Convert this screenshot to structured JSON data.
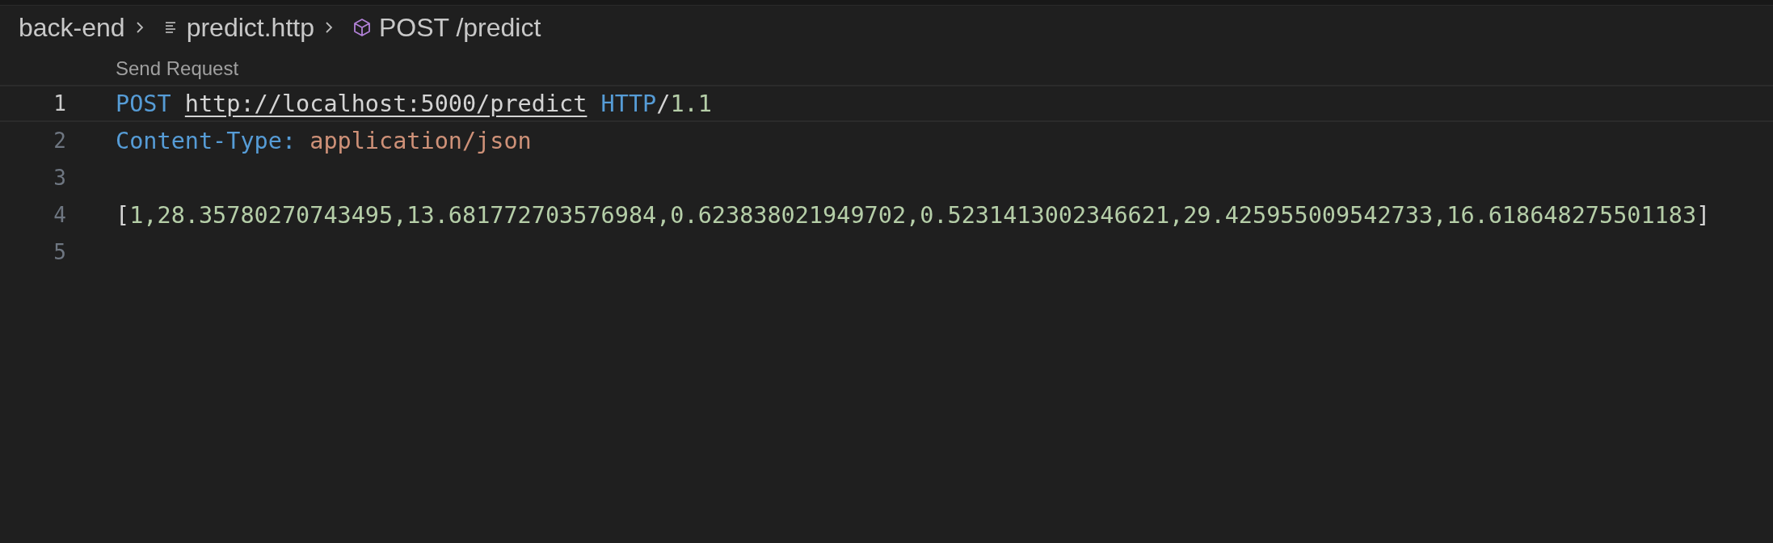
{
  "breadcrumbs": [
    {
      "label": "back-end",
      "kind": "folder"
    },
    {
      "label": "predict.http",
      "kind": "file"
    },
    {
      "label": "POST /predict",
      "kind": "symbol"
    }
  ],
  "codelens": "Send Request",
  "lines": [
    {
      "number": "1",
      "active": true,
      "tokens": [
        {
          "kind": "method",
          "text": "POST "
        },
        {
          "kind": "url",
          "text": "http://localhost:5000/predict"
        },
        {
          "kind": "method",
          "text": " HTTP"
        },
        {
          "kind": "plain",
          "text": "/"
        },
        {
          "kind": "number",
          "text": "1.1"
        }
      ]
    },
    {
      "number": "2",
      "active": false,
      "tokens": [
        {
          "kind": "method",
          "text": "Content-Type: "
        },
        {
          "kind": "string",
          "text": "application/json"
        }
      ]
    },
    {
      "number": "3",
      "active": false
    },
    {
      "number": "4",
      "active": false,
      "tokens": [
        {
          "kind": "plain",
          "text": "["
        },
        {
          "kind": "number",
          "text": "1,28.35780270743495,13.681772703576984,0.623838021949702,0.5231413002346621,29.425955009542733,16.618648275501183"
        },
        {
          "kind": "plain",
          "text": "]"
        }
      ]
    },
    {
      "number": "5",
      "active": false
    }
  ]
}
